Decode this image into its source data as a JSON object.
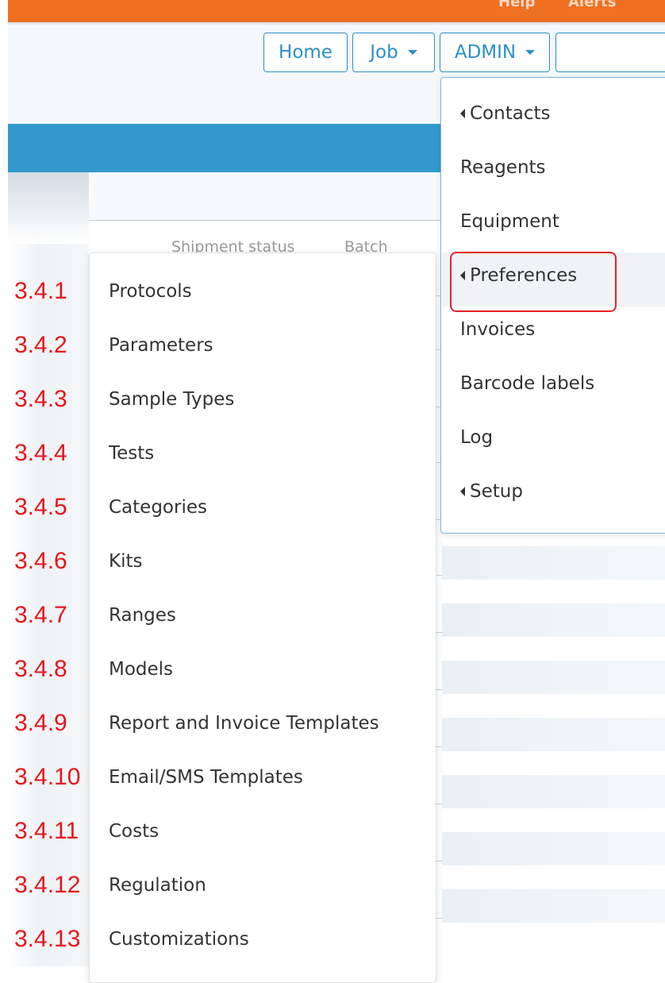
{
  "topbar": {
    "links": [
      "Help",
      "Alerts"
    ],
    "color_brand": "#f07022"
  },
  "nav": {
    "home_label": "Home",
    "job_label": "Job",
    "admin_label": "ADMIN",
    "search_placeholder": ""
  },
  "table": {
    "headers": [
      "Shipment status",
      "Batch"
    ]
  },
  "admin_menu": {
    "items": [
      {
        "label": "Contacts",
        "submenu": true
      },
      {
        "label": "Reagents",
        "submenu": false
      },
      {
        "label": "Equipment",
        "submenu": false
      },
      {
        "label": "Preferences",
        "submenu": true
      },
      {
        "label": "Invoices",
        "submenu": false
      },
      {
        "label": "Barcode labels",
        "submenu": false
      },
      {
        "label": "Log",
        "submenu": false
      },
      {
        "label": "Setup",
        "submenu": true
      }
    ],
    "active_item": "Preferences"
  },
  "preferences_submenu": {
    "items": [
      {
        "number": "3.4.1",
        "label": "Protocols"
      },
      {
        "number": "3.4.2",
        "label": "Parameters"
      },
      {
        "number": "3.4.3",
        "label": "Sample Types"
      },
      {
        "number": "3.4.4",
        "label": "Tests"
      },
      {
        "number": "3.4.5",
        "label": "Categories"
      },
      {
        "number": "3.4.6",
        "label": "Kits"
      },
      {
        "number": "3.4.7",
        "label": "Ranges"
      },
      {
        "number": "3.4.8",
        "label": "Models"
      },
      {
        "number": "3.4.9",
        "label": "Report and Invoice Templates"
      },
      {
        "number": "3.4.10",
        "label": "Email/SMS Templates"
      },
      {
        "number": "3.4.11",
        "label": "Costs"
      },
      {
        "number": "3.4.12",
        "label": "Regulation"
      },
      {
        "number": "3.4.13",
        "label": "Customizations"
      }
    ]
  },
  "colors": {
    "accent_blue": "#2b8fc6",
    "band_blue": "#3399cc",
    "annotation_red": "#e8141a"
  }
}
